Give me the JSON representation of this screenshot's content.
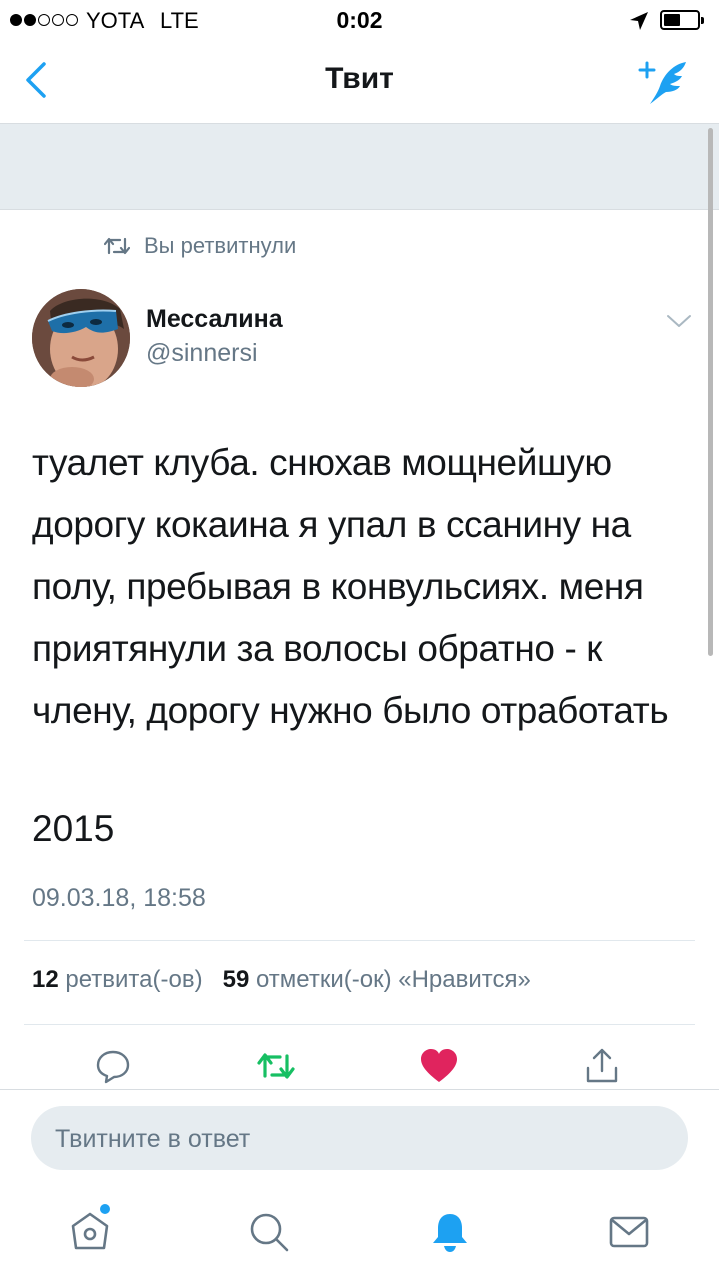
{
  "status_bar": {
    "carrier": "YOTA",
    "network": "LTE",
    "time": "0:02"
  },
  "nav": {
    "title": "Твит",
    "back_icon": "chevron-left-icon",
    "compose_icon": "compose-tweet-icon"
  },
  "tweet": {
    "retweet_context": "Вы ретвитнули",
    "author": {
      "name": "Мессалина",
      "handle": "@sinnersi"
    },
    "text": "туалет клуба. снюхав мощнейшую дорогу кокаина я упал в ссанину на полу, пребывая в конвульсиях. меня приятянули за волосы обратно - к члену, дорогу нужно было отработать",
    "year": "2015",
    "timestamp": "09.03.18, 18:58",
    "stats": {
      "retweets_count": "12",
      "retweets_label": "ретвита(-ов)",
      "likes_count": "59",
      "likes_label": "отметки(-ок) «Нравится»"
    }
  },
  "actions": [
    "reply-icon",
    "retweet-icon",
    "like-icon",
    "share-icon"
  ],
  "reply": {
    "placeholder": "Твитните в ответ"
  },
  "tab_bar": {
    "items": [
      "home-icon",
      "search-icon",
      "notifications-icon",
      "messages-icon"
    ],
    "active": "notifications-icon"
  },
  "colors": {
    "accent": "#1da1f2",
    "retweet_active": "#17bf63",
    "like_active": "#e0245e",
    "secondary_text": "#657786",
    "band": "#e6ecf0"
  }
}
